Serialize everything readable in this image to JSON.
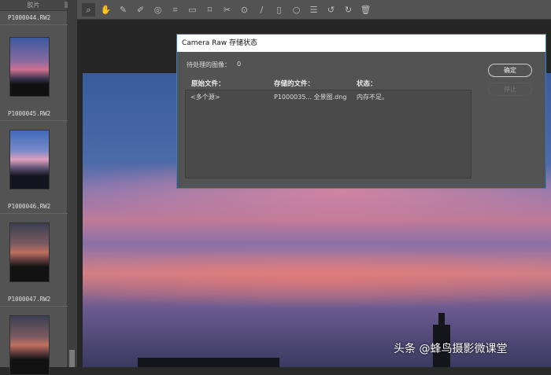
{
  "filmstrip": {
    "title": "胶片",
    "items": [
      {
        "name": "P1000044.RW2"
      },
      {
        "name": "P1000045.RW2"
      },
      {
        "name": "P1000046.RW2"
      },
      {
        "name": "P1000047.RW2"
      }
    ]
  },
  "toolbar": {
    "tools": [
      "zoom-icon",
      "hand-icon",
      "white-balance-icon",
      "color-sampler-icon",
      "targeted-adjustment-icon",
      "crop-icon",
      "straighten-icon",
      "transform-icon",
      "spot-removal-icon",
      "red-eye-icon",
      "adjustment-brush-icon",
      "graduated-filter-icon",
      "radial-filter-icon",
      "preferences-icon",
      "rotate-left-icon",
      "rotate-right-icon",
      "trash-icon"
    ]
  },
  "dialog": {
    "title": "Camera Raw 存储状态",
    "pending_label": "待处理的图像：",
    "pending_value": "0",
    "columns": [
      "原始文件：",
      "存储的文件：",
      "状态："
    ],
    "rows": [
      {
        "source": "<多个源>",
        "saved": "P1000035... 全景图.dng",
        "status": "内存不足。"
      }
    ],
    "ok_label": "确定",
    "stop_label": "停止"
  },
  "watermark": "头条 @蜂鸟摄影微课堂"
}
